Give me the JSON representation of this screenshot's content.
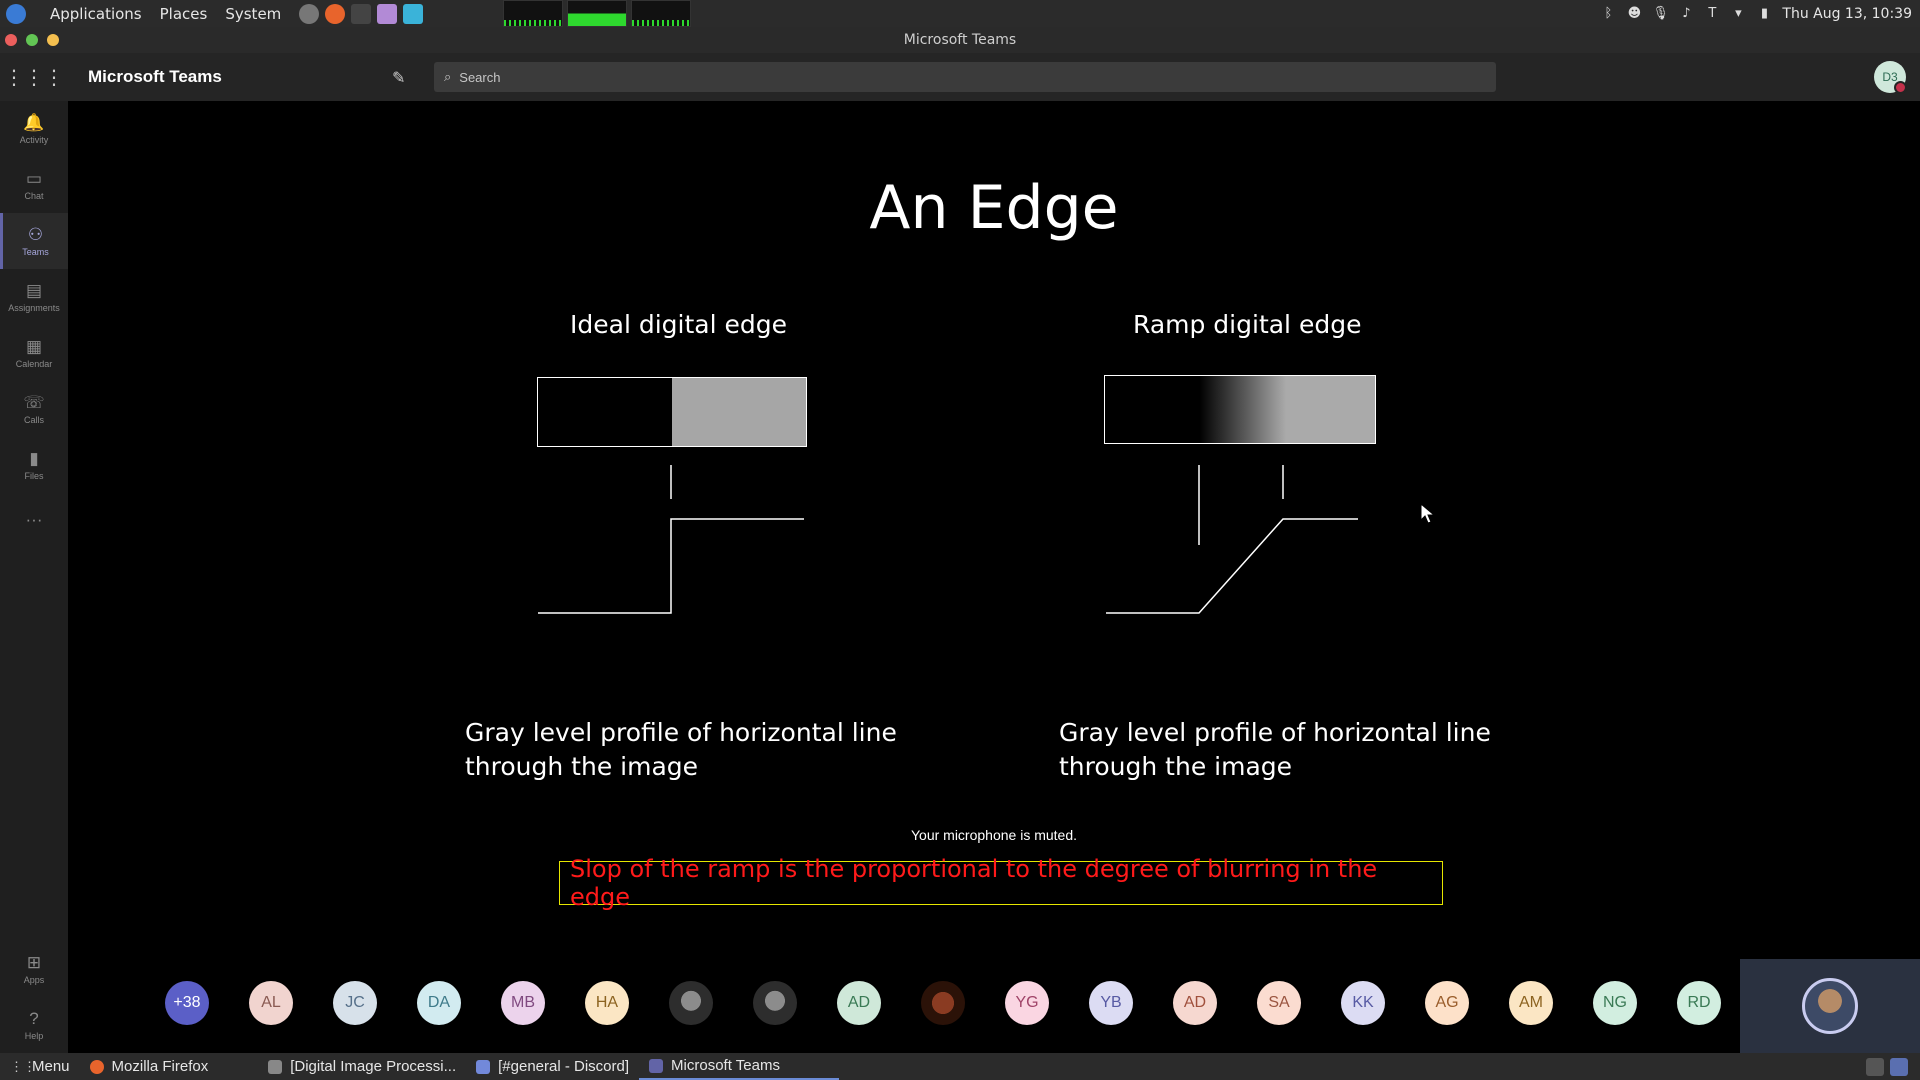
{
  "system_bar": {
    "menus": [
      "Applications",
      "Places",
      "System"
    ],
    "clock": "Thu Aug 13, 10:39"
  },
  "window": {
    "title": "Microsoft Teams"
  },
  "teams": {
    "app_name": "Microsoft Teams",
    "search_placeholder": "Search",
    "user_initials": "D3",
    "rail": [
      {
        "label": "Activity",
        "icon": "bell-icon"
      },
      {
        "label": "Chat",
        "icon": "chat-icon"
      },
      {
        "label": "Teams",
        "icon": "teams-icon"
      },
      {
        "label": "Assignments",
        "icon": "assignments-icon"
      },
      {
        "label": "Calendar",
        "icon": "calendar-icon"
      },
      {
        "label": "Calls",
        "icon": "phone-icon"
      },
      {
        "label": "Files",
        "icon": "files-icon"
      },
      {
        "label": "",
        "icon": "more-icon"
      }
    ],
    "rail_bottom": [
      {
        "label": "Apps",
        "icon": "apps-icon"
      },
      {
        "label": "Help",
        "icon": "help-icon"
      }
    ]
  },
  "slide": {
    "title": "An Edge",
    "left_heading": "Ideal digital edge",
    "right_heading": "Ramp digital edge",
    "left_caption": "Gray level profile of horizontal line through the image",
    "right_caption": "Gray level profile of horizontal line through the image",
    "note": "Slop of the ramp is the proportional to the degree of blurring  in the edge"
  },
  "status": {
    "mic_muted": "Your microphone is muted."
  },
  "participants": {
    "overflow": "+38",
    "people": [
      {
        "initials": "AL",
        "bg": "#f1d4cf",
        "fg": "#8a5a52"
      },
      {
        "initials": "JC",
        "bg": "#d7e1ea",
        "fg": "#56708a"
      },
      {
        "initials": "DA",
        "bg": "#d2ebf0",
        "fg": "#3f7b8a"
      },
      {
        "initials": "MB",
        "bg": "#ecd3ec",
        "fg": "#804a80"
      },
      {
        "initials": "HA",
        "bg": "#fbe6c4",
        "fg": "#8c6320"
      },
      {
        "initials": "",
        "bg": "photo2",
        "fg": ""
      },
      {
        "initials": "",
        "bg": "photo2",
        "fg": ""
      },
      {
        "initials": "AD",
        "bg": "#cfe8d9",
        "fg": "#3a7a55"
      },
      {
        "initials": "",
        "bg": "photo3",
        "fg": ""
      },
      {
        "initials": "YG",
        "bg": "#fad6e2",
        "fg": "#a04468"
      },
      {
        "initials": "YB",
        "bg": "#dcdcf3",
        "fg": "#575aa3"
      },
      {
        "initials": "AD",
        "bg": "#f6d8d0",
        "fg": "#a0503c"
      },
      {
        "initials": "SA",
        "bg": "#fbdcd0",
        "fg": "#9a5540"
      },
      {
        "initials": "KK",
        "bg": "#dcdcf3",
        "fg": "#575aa3"
      },
      {
        "initials": "AG",
        "bg": "#fde1c9",
        "fg": "#9a5d2b"
      },
      {
        "initials": "AM",
        "bg": "#fbe6c4",
        "fg": "#8c6320"
      },
      {
        "initials": "NG",
        "bg": "#d2eee0",
        "fg": "#3a7a55"
      },
      {
        "initials": "RD",
        "bg": "#d2eee0",
        "fg": "#3a7a55"
      }
    ]
  },
  "taskbar": {
    "menu": "Menu",
    "items": [
      {
        "label": "Mozilla Firefox",
        "color": "#e8642c"
      },
      {
        "label": "[Digital Image Processi...",
        "color": "#888888"
      },
      {
        "label": "[#general - Discord]",
        "color": "#7289da"
      },
      {
        "label": "Microsoft Teams",
        "color": "#6264a7"
      }
    ]
  }
}
